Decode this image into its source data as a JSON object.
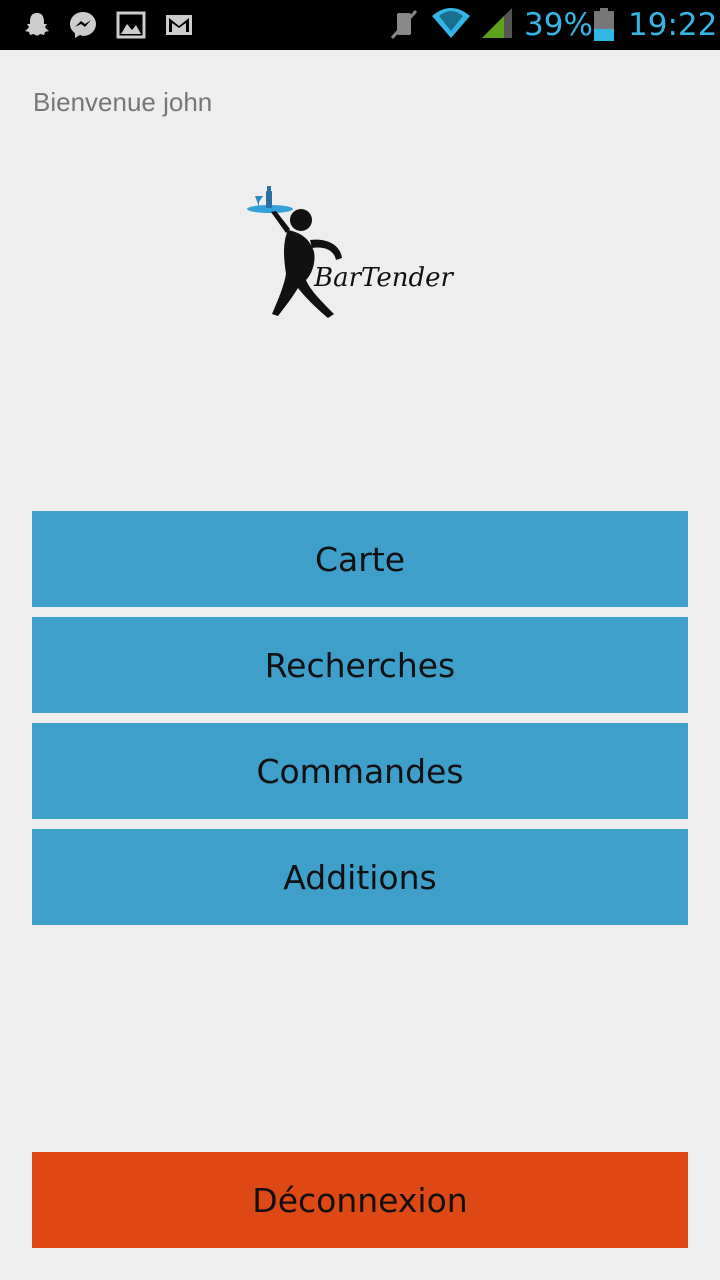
{
  "status_bar": {
    "battery_percent": "39%",
    "time": "19:22",
    "accent_color": "#33b5e5",
    "notification_icons": [
      "snapchat-icon",
      "messenger-icon",
      "gallery-icon",
      "gmail-icon"
    ],
    "system_icons": [
      "mute-icon",
      "wifi-icon",
      "signal-icon",
      "battery-icon"
    ]
  },
  "header": {
    "welcome": "Bienvenue john"
  },
  "logo": {
    "text": "BarTender",
    "name": "bartender-logo"
  },
  "menu": {
    "button_color": "#3d9fca",
    "items": [
      {
        "label": "Carte"
      },
      {
        "label": "Recherches"
      },
      {
        "label": "Commandes"
      },
      {
        "label": "Additions"
      }
    ]
  },
  "logout": {
    "label": "Déconnexion",
    "color": "#dd4814"
  }
}
